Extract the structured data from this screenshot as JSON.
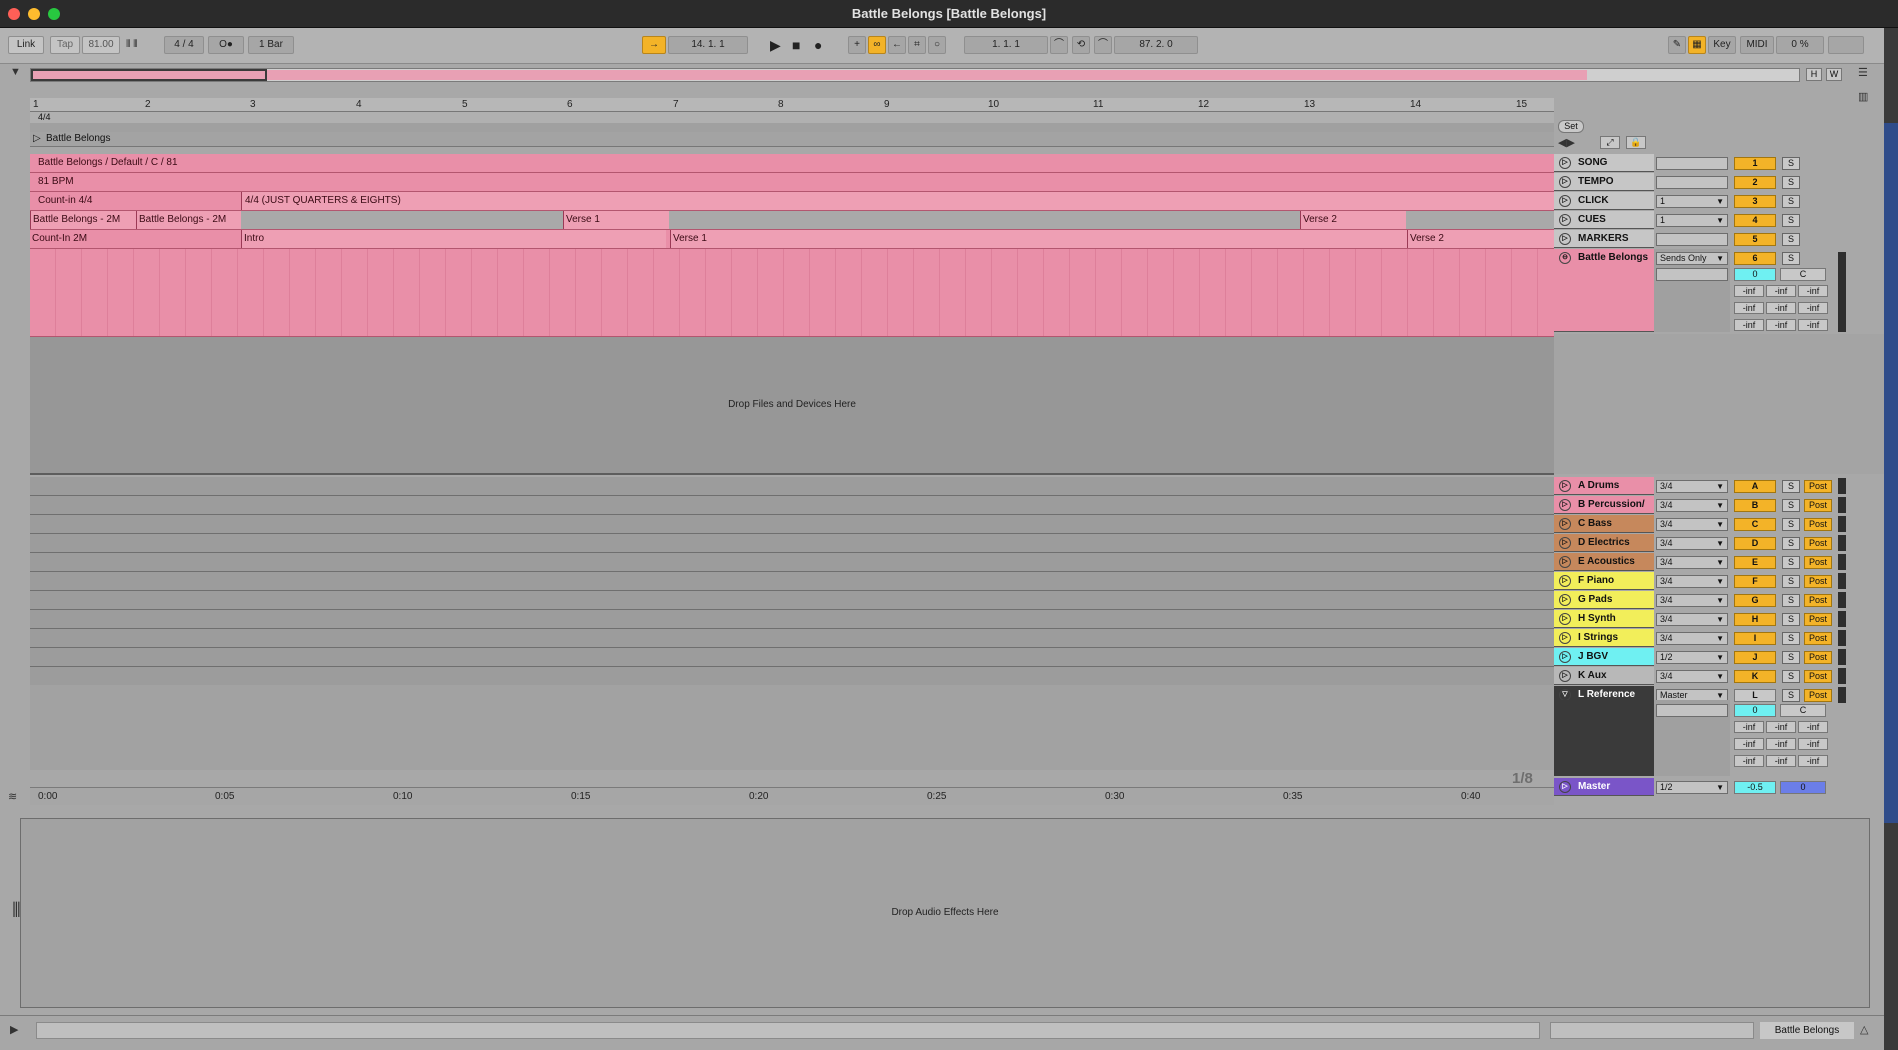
{
  "window": {
    "title": "Battle Belongs  [Battle Belongs]"
  },
  "control_bar": {
    "link": "Link",
    "tap": "Tap",
    "tempo": "81.00",
    "signature": "4 / 4",
    "metronome": "O●",
    "quantize": "1 Bar",
    "position": "14.   1.   1",
    "loop_start": "1.   1.   1",
    "loop_length": "87.   2.   0",
    "key": "Key",
    "midi": "MIDI",
    "cpu": "0 %"
  },
  "overview": {
    "h_label": "H",
    "w_label": "W"
  },
  "ruler": {
    "bars": [
      "1",
      "2",
      "3",
      "4",
      "5",
      "6",
      "7",
      "8",
      "9",
      "10",
      "11",
      "12",
      "13",
      "14",
      "15"
    ],
    "signature": "4/4",
    "song_label": "Battle Belongs",
    "set_button": "Set"
  },
  "lanes": [
    {
      "name": "SONG",
      "text": "Battle Belongs / Default / C / 81",
      "number": "1"
    },
    {
      "name": "TEMPO",
      "text": "81 BPM",
      "number": "2"
    },
    {
      "name": "CLICK",
      "clips": [
        "Count-in 4/4",
        "4/4 (JUST QUARTERS & EIGHTS)"
      ],
      "number": "3",
      "io": "1"
    },
    {
      "name": "CUES",
      "clips": [
        "Battle Belongs - 2M",
        "Battle Belongs - 2M",
        "Verse 1",
        "Verse 2"
      ],
      "number": "4",
      "io": "1"
    },
    {
      "name": "MARKERS",
      "clips": [
        "Count-In 2M",
        "Intro",
        "Verse 1",
        "Verse 2"
      ],
      "number": "5"
    }
  ],
  "battle_track": {
    "name": "Battle Belongs",
    "io": "Sends Only",
    "number": "6",
    "vol": "0",
    "pan": "C",
    "inf": "-inf"
  },
  "drop_files": "Drop Files and Devices Here",
  "groups": [
    {
      "name": "A Drums",
      "io": "3/4",
      "letter": "A"
    },
    {
      "name": "B Percussion/",
      "io": "3/4",
      "letter": "B"
    },
    {
      "name": "C Bass",
      "io": "3/4",
      "letter": "C"
    },
    {
      "name": "D Electrics",
      "io": "3/4",
      "letter": "D"
    },
    {
      "name": "E Acoustics",
      "io": "3/4",
      "letter": "E"
    },
    {
      "name": "F Piano",
      "io": "3/4",
      "letter": "F"
    },
    {
      "name": "G Pads",
      "io": "3/4",
      "letter": "G"
    },
    {
      "name": "H Synth",
      "io": "3/4",
      "letter": "H"
    },
    {
      "name": "I Strings",
      "io": "3/4",
      "letter": "I"
    },
    {
      "name": "J BGV",
      "io": "1/2",
      "letter": "J"
    },
    {
      "name": "K Aux",
      "io": "3/4",
      "letter": "K"
    },
    {
      "name": "L Reference",
      "io": "Master",
      "letter": "L"
    }
  ],
  "solo": "S",
  "post": "Post",
  "ref": {
    "vol": "0",
    "pan": "C"
  },
  "master": {
    "name": "Master",
    "io": "1/2",
    "vol": "-0.5",
    "pan": "0"
  },
  "pager": "1/8",
  "timeline": [
    "0:00",
    "0:05",
    "0:10",
    "0:15",
    "0:20",
    "0:25",
    "0:30",
    "0:35",
    "0:40"
  ],
  "drop_audio": "Drop Audio Effects Here",
  "status": {
    "set_name": "Battle Belongs"
  },
  "colors": {
    "pink": "#e98fa8",
    "orange_yellow": "#f3b328",
    "group_brown": "#c6885c",
    "group_yellow": "#f2ee5a",
    "group_cyan": "#6ff0f2",
    "master_purple": "#7a55c8"
  }
}
